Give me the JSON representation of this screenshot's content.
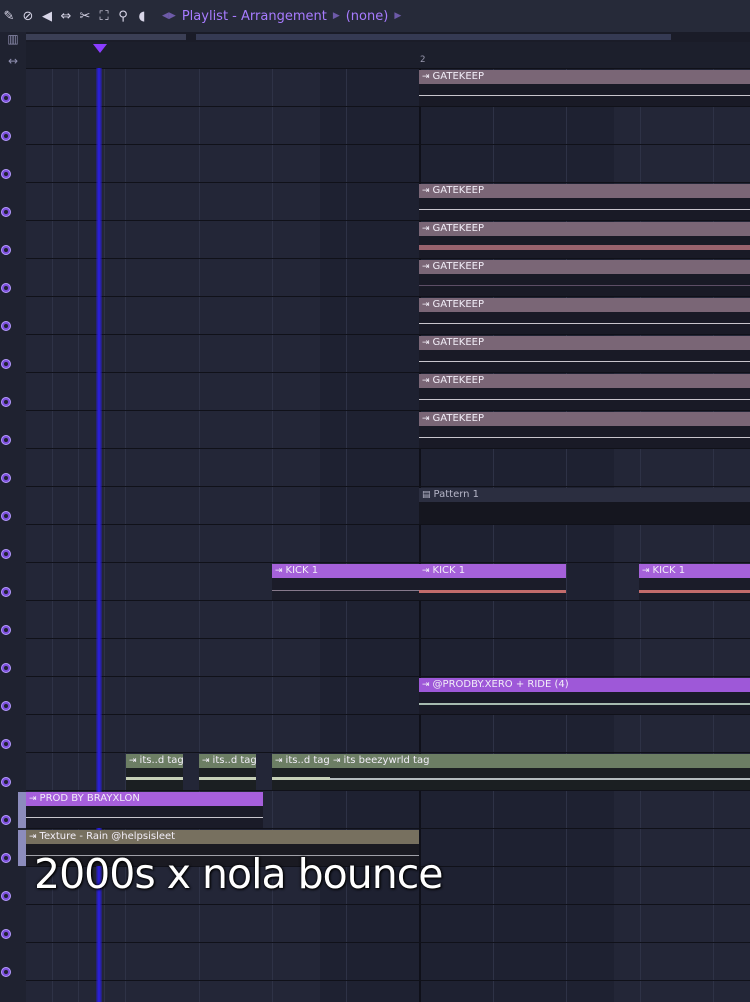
{
  "toolbar": {
    "icons": [
      "draw-icon",
      "mute-disable-icon",
      "mute-icon",
      "slip-icon",
      "slice-icon",
      "select-icon",
      "zoom-icon",
      "playback-icon"
    ],
    "title": "Playlist - Arrangement",
    "pattern": "(none)"
  },
  "ruler": {
    "marker": "2"
  },
  "clips": {
    "gatekeep": "GATEKEEP",
    "pattern": "Pattern 1",
    "kick": "KICK 1",
    "ride": "@PRODBY.XERO + RIDE (4)",
    "tag_short": "its..d tag",
    "tag_long": "its beezywrld tag",
    "prod": "PROD BY BRAYXLON",
    "texture": "Texture - Rain @helpsisleet"
  },
  "caption": "2000s x nola bounce",
  "colors": {
    "accent": "#a77bff",
    "playhead": "#2a1fd8",
    "gatekeep_header": "#7a6676",
    "kick_header": "#a561d9",
    "tag_header": "#6c7e64",
    "texture_header": "#77705f"
  }
}
